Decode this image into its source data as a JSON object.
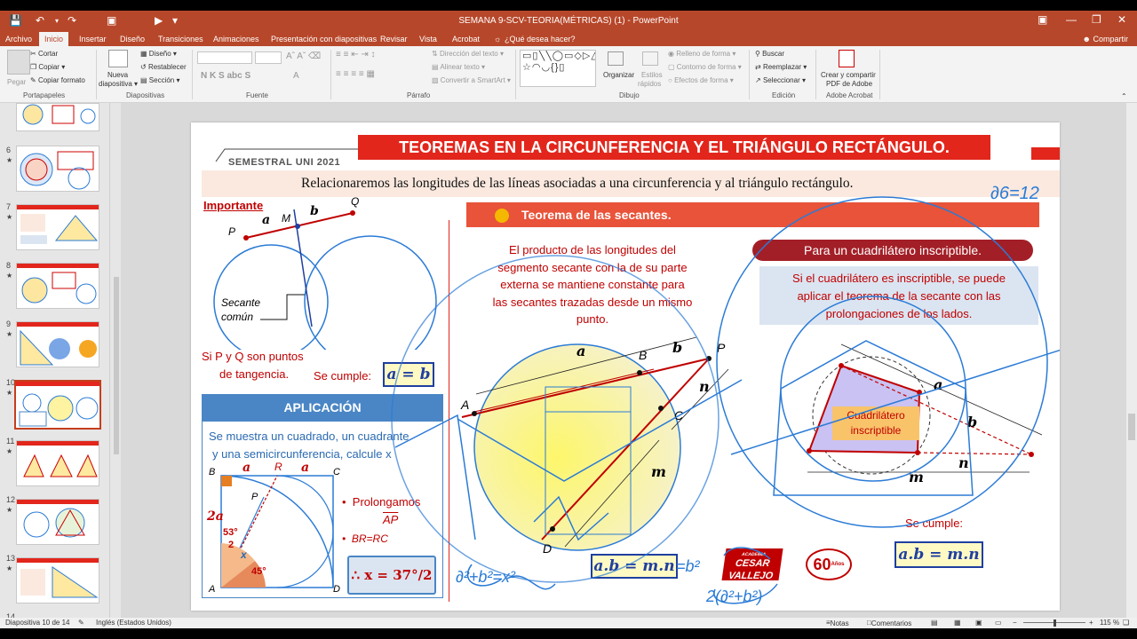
{
  "titlebar": {
    "doc_title": "SEMANA 9-SCV-TEORIA(MÉTRICAS) (1) - PowerPoint",
    "save_icon": "save-icon",
    "undo_icon": "undo-icon",
    "redo_icon": "redo-icon"
  },
  "tabs": {
    "items": [
      "Archivo",
      "Inicio",
      "Insertar",
      "Diseño",
      "Transiciones",
      "Animaciones",
      "Presentación con diapositivas",
      "Revisar",
      "Vista",
      "Acrobat"
    ],
    "tell_me": "¿Qué desea hacer?",
    "share": "Compartir"
  },
  "ribbon": {
    "clipboard": {
      "paste": "Pegar",
      "cut": "Cortar",
      "copy": "Copiar",
      "format_painter": "Copiar formato",
      "group": "Portapapeles"
    },
    "slides": {
      "new_slide": "Nueva",
      "new_slide_2": "diapositiva",
      "layout": "Diseño",
      "reset": "Restablecer",
      "section": "Sección",
      "group": "Diapositivas"
    },
    "font": {
      "group": "Fuente",
      "buttons": "N  K  S  abc  S",
      "buttons2": "A"
    },
    "paragraph": {
      "text_direction": "Dirección del texto",
      "align_text": "Alinear texto",
      "smartart": "Convertir a SmartArt",
      "group": "Párrafo"
    },
    "drawing": {
      "shapes": "▭▯╲╲◯▭◇▷△⌐↘⬡▭▭⟨⟩☆◠◡{}▯",
      "arrange": "Organizar",
      "quick_styles": "Estilos",
      "quick_styles_2": "rápidos",
      "fill": "Relleno de forma",
      "outline": "Contorno de forma",
      "effects": "Efectos de forma",
      "group": "Dibujo"
    },
    "editing": {
      "find": "Buscar",
      "replace": "Reemplazar",
      "select": "Seleccionar",
      "group": "Edición"
    },
    "acrobat": {
      "create_pdf": "Crear y compartir",
      "create_pdf_2": "PDF de Adobe",
      "group": "Adobe Acrobat"
    }
  },
  "thumbnails": [
    {
      "num": "",
      "star": ""
    },
    {
      "num": "6",
      "star": "★"
    },
    {
      "num": "7",
      "star": "★"
    },
    {
      "num": "8",
      "star": "★"
    },
    {
      "num": "9",
      "star": "★"
    },
    {
      "num": "10",
      "star": "★"
    },
    {
      "num": "11",
      "star": "★"
    },
    {
      "num": "12",
      "star": "★"
    },
    {
      "num": "13",
      "star": "★"
    },
    {
      "num": "14",
      "star": ""
    }
  ],
  "slide": {
    "semestral": "SEMESTRAL UNI 2021",
    "title": "TEOREMAS EN LA CIRCUNFERENCIA Y EL TRIÁNGULO RECTÁNGULO.",
    "subtitle": "Relacionaremos las longitudes de las líneas asociadas a una circunferencia y al triángulo rectángulo.",
    "importante": "Importante",
    "secante_comun_1": "Secante",
    "secante_comun_2": "común",
    "tangencia_1": "Si P y Q son puntos",
    "tangencia_2": "de tangencia.",
    "se_cumple_1": "Se cumple:",
    "formula_ab": "a = b",
    "aplicacion": "APLICACIÓN",
    "aplic_text_1": "Se muestra un cuadrado, un cuadrante",
    "aplic_text_2": "y una semicircunferencia, calcule x",
    "prolongamos": "Prolongamos",
    "ap": "AP",
    "br_rc": "BR=RC",
    "answer": "∴ x = 37°/2",
    "secantes_title": "Teorema de las secantes.",
    "secantes_text": [
      "El producto de las longitudes del",
      "segmento secante con la de su parte",
      "externa se mantiene constante para",
      "las secantes trazadas desde un mismo",
      "punto."
    ],
    "formula_secantes": "a.b = m.n",
    "cuadri_title": "Para un cuadrilátero inscriptible.",
    "cuadri_text": [
      "Si el cuadrilátero es inscriptible, se puede",
      "aplicar el teorema de la secante con las",
      "prolongaciones de los lados."
    ],
    "cuadri_label_1": "Cuadrilátero",
    "cuadri_label_2": "inscriptible",
    "se_cumple_2": "Se cumple:",
    "formula_cuadri": "a.b = m.n",
    "logo_1": "CESAR",
    "logo_2": "VALLEJO",
    "logo_academia": "ACADEMIA",
    "logo_60": "60",
    "logo_anos": "Años",
    "labels": {
      "P": "P",
      "Q": "Q",
      "M": "M",
      "a": "a",
      "b": "b",
      "A": "A",
      "B": "B",
      "C": "C",
      "D": "D",
      "m": "m",
      "n": "n",
      "R": "R",
      "x": "x",
      "2a": "2a",
      "53": "53°",
      "45": "45°",
      "half": "2"
    },
    "ink": {
      "top_right": "∂6=12",
      "eq1": "∂²+b²=x²",
      "eq2": "2(∂²+b²)",
      "expr": "=b²"
    }
  },
  "status": {
    "slide_of": "Diapositiva 10 de 14",
    "language": "Inglés (Estados Unidos)",
    "notes": "Notas",
    "comments": "Comentarios",
    "zoom": "115 %"
  },
  "colors": {
    "accent": "#b7472a",
    "banner": "#e2261c",
    "ink": "#2b7bd6",
    "formula_border": "#1f3fa0"
  }
}
